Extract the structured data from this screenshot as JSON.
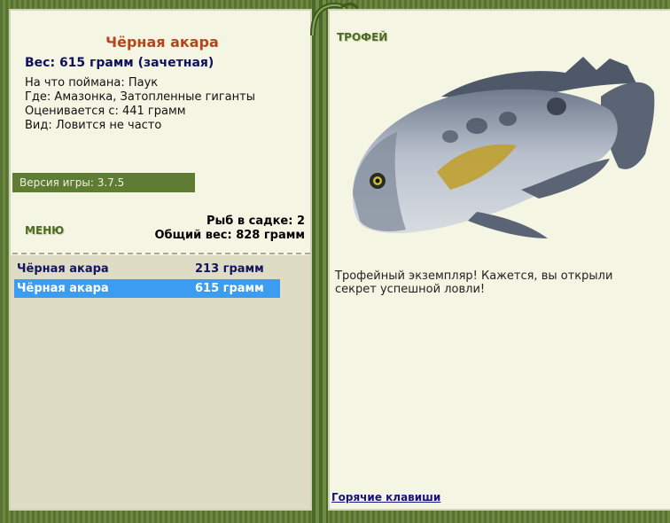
{
  "fish": {
    "name": "Чёрная акара",
    "weight": "Вес: 615 грамм (зачетная)",
    "bait": "На что поймана: Паук",
    "location": "Где: Амазонка, Затопленные гиганты",
    "valued_from": "Оценивается с: 441 грамм",
    "rarity": "Вид: Ловится не часто"
  },
  "version": "Версия игры: 3.7.5",
  "menu": {
    "label": "МЕНЮ"
  },
  "keep_net": {
    "count_line": "Рыб в садке: 2",
    "total_weight_line": "Общий вес: 828 грамм"
  },
  "catch_list": [
    {
      "name": "Чёрная акара",
      "weight": "213 грамм",
      "selected": false
    },
    {
      "name": "Чёрная акара",
      "weight": "615 грамм",
      "selected": true
    }
  ],
  "trophy": {
    "label": "ТРОФЕЙ",
    "message": "Трофейный экземпляр! Кажется, вы открыли секрет успешной ловли!"
  },
  "hotkeys_link": "Горячие клавиши",
  "colors": {
    "frame_green": "#5f7a36",
    "panel_bg": "#f5f5e4",
    "title_orange": "#b5461b",
    "selected_blue": "#3c9cf0"
  }
}
